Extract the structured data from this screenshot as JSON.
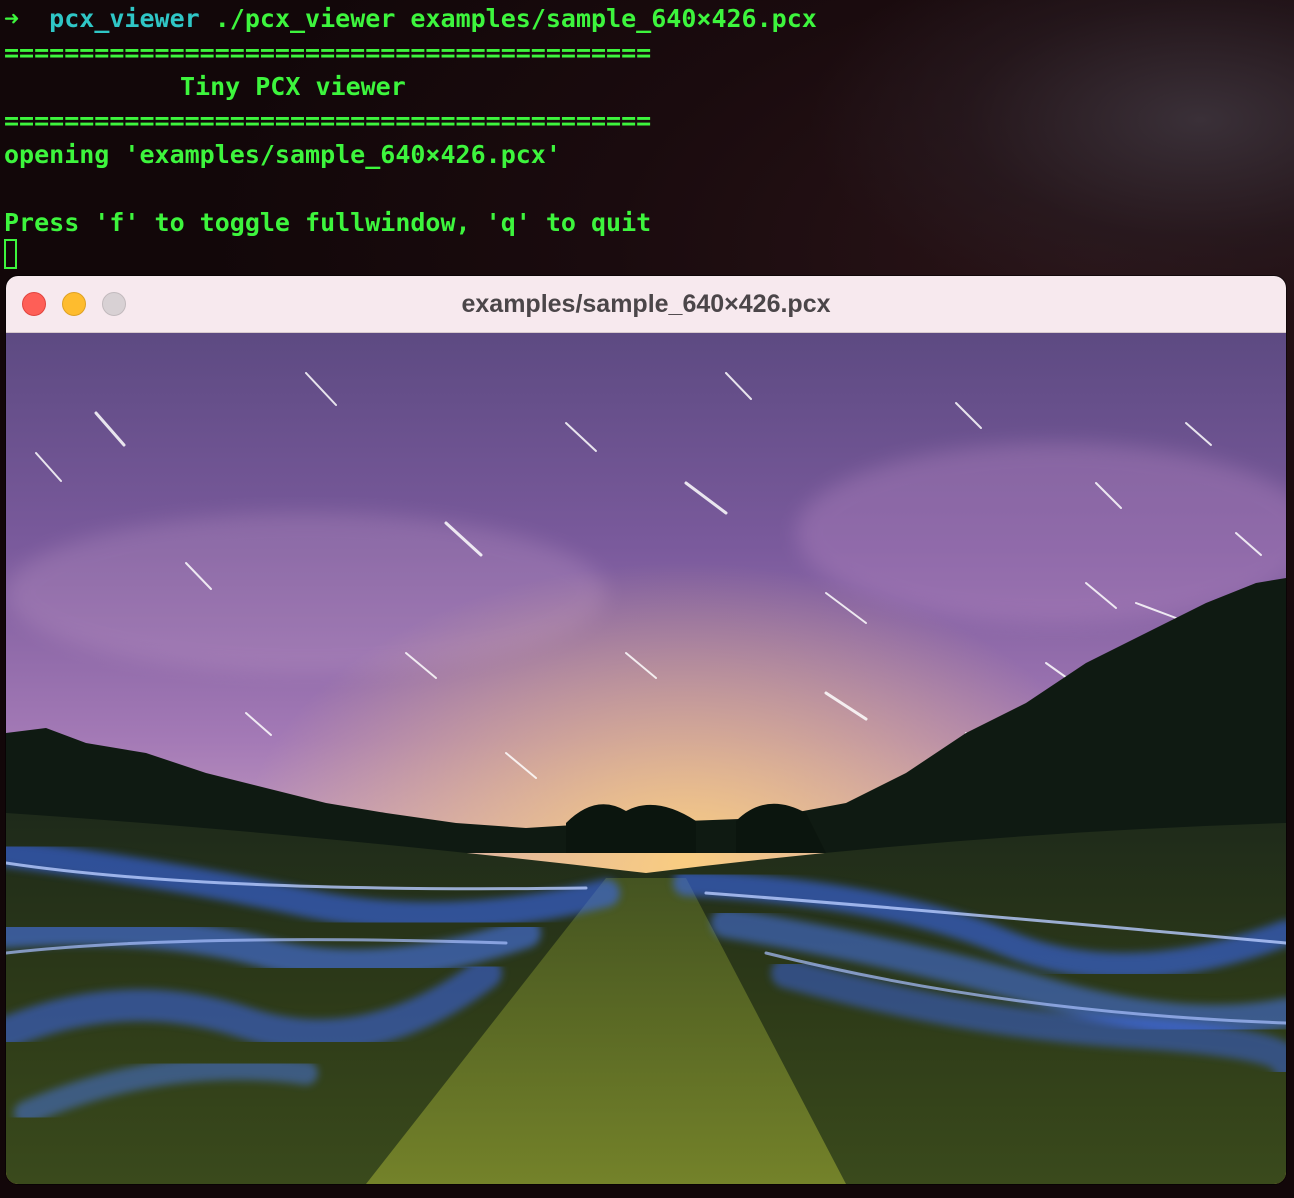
{
  "terminal": {
    "prompt_arrow": "➜",
    "command": "pcx_viewer",
    "arguments": "./pcx_viewer examples/sample_640×426.pcx",
    "divider_top": "===========================================",
    "banner": "Tiny PCX viewer",
    "divider_bottom": "===========================================",
    "opening_message": "opening 'examples/sample_640×426.pcx'",
    "instructions": "Press 'f' to toggle fullwindow, 'q' to quit"
  },
  "window": {
    "title": "examples/sample_640×426.pcx",
    "image_description_icon": "night-sky-field-photo"
  },
  "colors": {
    "terminal_text": "#3df53d",
    "command_text": "#2fc6c6",
    "titlebar_bg": "#f7e9ee",
    "close_light": "#fe5f57",
    "minimize_light": "#febc2e",
    "maximize_light_inactive": "#d8d1d4"
  }
}
